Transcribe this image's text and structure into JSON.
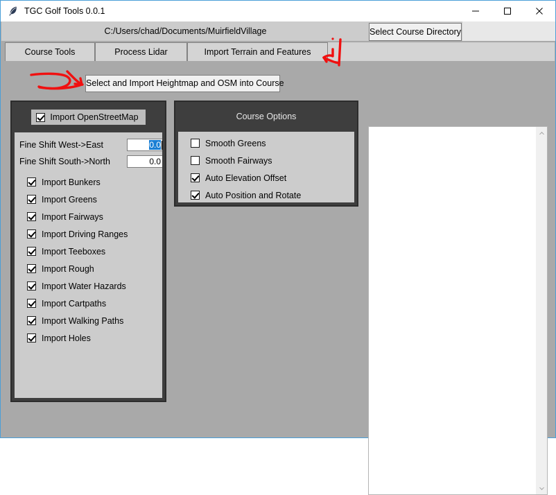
{
  "window": {
    "title": "TGC Golf Tools 0.0.1",
    "icon": "feather-icon",
    "controls": {
      "minimize": "minimize-icon",
      "maximize": "maximize-icon",
      "close": "close-icon"
    },
    "border_color": "#4a9fd8",
    "background_color": "#a9a9a9"
  },
  "path_bar": {
    "path": "C:/Users/chad/Documents/MuirfieldVillage",
    "select_directory_label": "Select Course Directory"
  },
  "tabs": [
    {
      "label": "Course Tools",
      "active": false
    },
    {
      "label": "Process Lidar",
      "active": false
    },
    {
      "label": "Import Terrain and Features",
      "active": true
    }
  ],
  "main": {
    "import_button_label": "Select and Import Heightmap and OSM into Course"
  },
  "osm_panel": {
    "title": "Import OpenStreetMap",
    "title_checked": true,
    "fields": [
      {
        "label": "Fine Shift West->East",
        "value": "0.0",
        "selected": true
      },
      {
        "label": "Fine Shift South->North",
        "value": "0.0",
        "selected": false
      }
    ],
    "checkboxes": [
      {
        "label": "Import Bunkers",
        "checked": true
      },
      {
        "label": "Import Greens",
        "checked": true
      },
      {
        "label": "Import Fairways",
        "checked": true
      },
      {
        "label": "Import Driving Ranges",
        "checked": true
      },
      {
        "label": "Import Teeboxes",
        "checked": true
      },
      {
        "label": "Import Rough",
        "checked": true
      },
      {
        "label": "Import Water Hazards",
        "checked": true
      },
      {
        "label": "Import Cartpaths",
        "checked": true
      },
      {
        "label": "Import Walking Paths",
        "checked": true
      },
      {
        "label": "Import Holes",
        "checked": true
      }
    ]
  },
  "course_options_panel": {
    "title": "Course Options",
    "checkboxes": [
      {
        "label": "Smooth Greens",
        "checked": false
      },
      {
        "label": "Smooth Fairways",
        "checked": false
      },
      {
        "label": "Auto Elevation Offset",
        "checked": true
      },
      {
        "label": "Auto Position and Rotate",
        "checked": true
      }
    ]
  },
  "output_pane": {
    "text": "",
    "scroll_up_icon": "chevron-up-icon",
    "scroll_down_icon": "chevron-down-icon"
  },
  "annotations": {
    "color": "#f01010",
    "marks": [
      {
        "name": "arrow-to-import-button",
        "description": "hand drawn red arrow pointing right at the import button"
      },
      {
        "name": "arrow-to-active-tab",
        "description": "hand drawn red arrow and vertical stroke near the Import Terrain and Features tab"
      }
    ]
  }
}
